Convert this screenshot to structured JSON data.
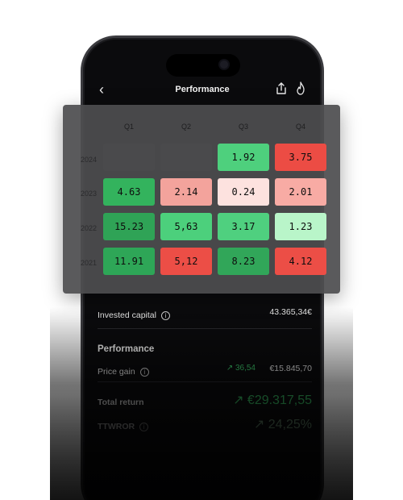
{
  "header": {
    "title": "Performance"
  },
  "heatmap": {
    "quarters": [
      "Q1",
      "Q2",
      "Q3",
      "Q4"
    ],
    "years": [
      "2024",
      "2023",
      "2022",
      "2021"
    ],
    "rows": [
      [
        "",
        "",
        "1.92",
        "3.75"
      ],
      [
        "4.63",
        "2.14",
        "0.24",
        "2.01"
      ],
      [
        "15.23",
        "5,63",
        "3.17",
        "1.23"
      ],
      [
        "11.91",
        "5,12",
        "8.23",
        "4.12"
      ]
    ],
    "colors": [
      [
        "#4a4a4c",
        "#4a4a4c",
        "#4ed07d",
        "#ec4c44"
      ],
      [
        "#33b35d",
        "#f3a39c",
        "#fde2df",
        "#f8aba4"
      ],
      [
        "#2fa356",
        "#4cd07c",
        "#4fd07f",
        "#b9f5c9"
      ],
      [
        "#2ea657",
        "#ec4e46",
        "#31a659",
        "#ec4e46"
      ]
    ]
  },
  "stats": {
    "invested_label": "Invested capital",
    "invested_value": "43.365,34€",
    "section_title": "Performance",
    "price_gain_label": "Price gain",
    "price_gain_pct": "↗ 36,54",
    "price_gain_value": "€15.845,70",
    "total_return_label": "Total return",
    "total_return_value": "↗ €29.317,55",
    "ttwror_label": "TTWROR",
    "ttwror_value": "↗ 24,25%"
  },
  "icons": {
    "back": "chevron-left-icon",
    "share": "share-icon",
    "flame": "flame-icon",
    "info": "info-icon"
  },
  "colors": {
    "accent_green": "#3ecb6d",
    "accent_red": "#ec4c44"
  }
}
